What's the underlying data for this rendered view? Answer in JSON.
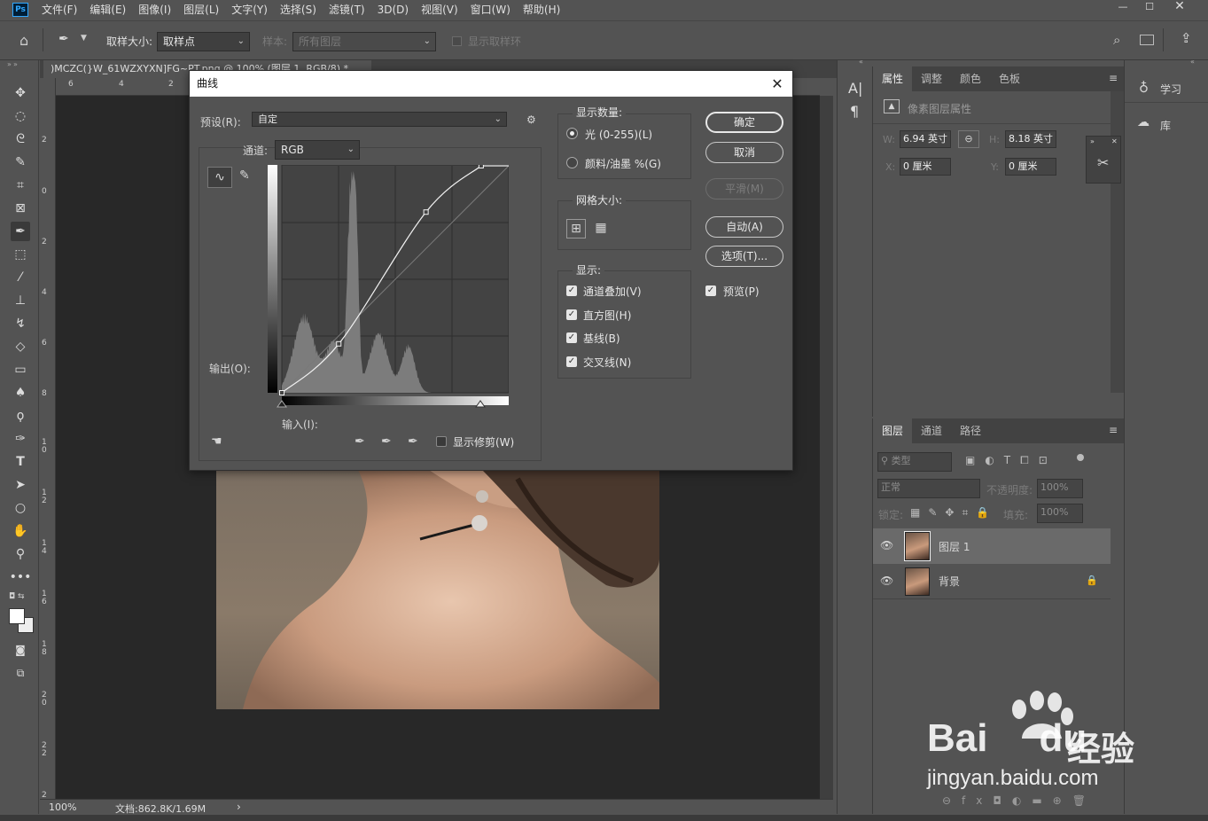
{
  "app": {
    "logo": "Ps"
  },
  "menu": [
    "文件(F)",
    "编辑(E)",
    "图像(I)",
    "图层(L)",
    "文字(Y)",
    "选择(S)",
    "滤镜(T)",
    "3D(D)",
    "视图(V)",
    "窗口(W)",
    "帮助(H)"
  ],
  "options": {
    "sample_size_label": "取样大小:",
    "sample_size_value": "取样点",
    "sample_label": "样本:",
    "sample_value": "所有图层",
    "show_ring_label": "显示取样环"
  },
  "document": {
    "tab_title": ")MCZC(}W_61WZXYXN]FG~PT.png @ 100% (图层 1, RGB/8) *",
    "zoom": "100%",
    "doc_size": "文档:862.8K/1.69M",
    "ruler_top": [
      "6",
      "4",
      "2"
    ],
    "ruler_left": [
      "2",
      "0",
      "2",
      "4",
      "6",
      "8",
      "1\n0",
      "1\n2",
      "1\n4",
      "1\n6",
      "1\n8",
      "2\n0",
      "2\n2",
      "2"
    ]
  },
  "curves": {
    "title": "曲线",
    "preset_label": "预设(R):",
    "preset_value": "自定",
    "channel_label": "通道:",
    "channel_value": "RGB",
    "output_label": "输出(O):",
    "input_label": "输入(I):",
    "show_clipping_label": "显示修剪(W)",
    "points": [
      [
        0,
        0
      ],
      [
        64,
        55
      ],
      [
        162,
        203
      ],
      [
        224,
        255
      ]
    ],
    "display_amount": {
      "title": "显示数量:",
      "light": "光 (0-255)(L)",
      "pigment": "颜料/油墨 %(G)"
    },
    "grid_size": {
      "title": "网格大小:"
    },
    "show": {
      "title": "显示:",
      "channel_overlay": "通道叠加(V)",
      "histogram": "直方图(H)",
      "baseline": "基线(B)",
      "intersection": "交叉线(N)"
    },
    "buttons": {
      "ok": "确定",
      "cancel": "取消",
      "smooth": "平滑(M)",
      "auto": "自动(A)",
      "options": "选项(T)..."
    },
    "preview_label": "预览(P)"
  },
  "properties": {
    "tabs": [
      "属性",
      "调整",
      "颜色",
      "色板"
    ],
    "subtitle": "像素图层属性",
    "w_label": "W:",
    "w_value": "6.94 英寸",
    "h_label": "H:",
    "h_value": "8.18 英寸",
    "x_label": "X:",
    "x_value": "0 厘米",
    "y_label": "Y:",
    "y_value": "0 厘米"
  },
  "layers": {
    "tabs": [
      "图层",
      "通道",
      "路径"
    ],
    "filter_label": "类型",
    "blend_mode": "正常",
    "opacity_label": "不透明度:",
    "opacity_value": "100%",
    "lock_label": "锁定:",
    "fill_label": "填充:",
    "fill_value": "100%",
    "items": [
      {
        "name": "图层 1",
        "selected": true
      },
      {
        "name": "背景",
        "locked": true
      }
    ]
  },
  "learn_panel": {
    "learn": "学习",
    "library": "库"
  },
  "watermark": {
    "brand": "Bai",
    "du": "du",
    "jingyan": "经验",
    "url": "jingyan.baidu.com"
  }
}
